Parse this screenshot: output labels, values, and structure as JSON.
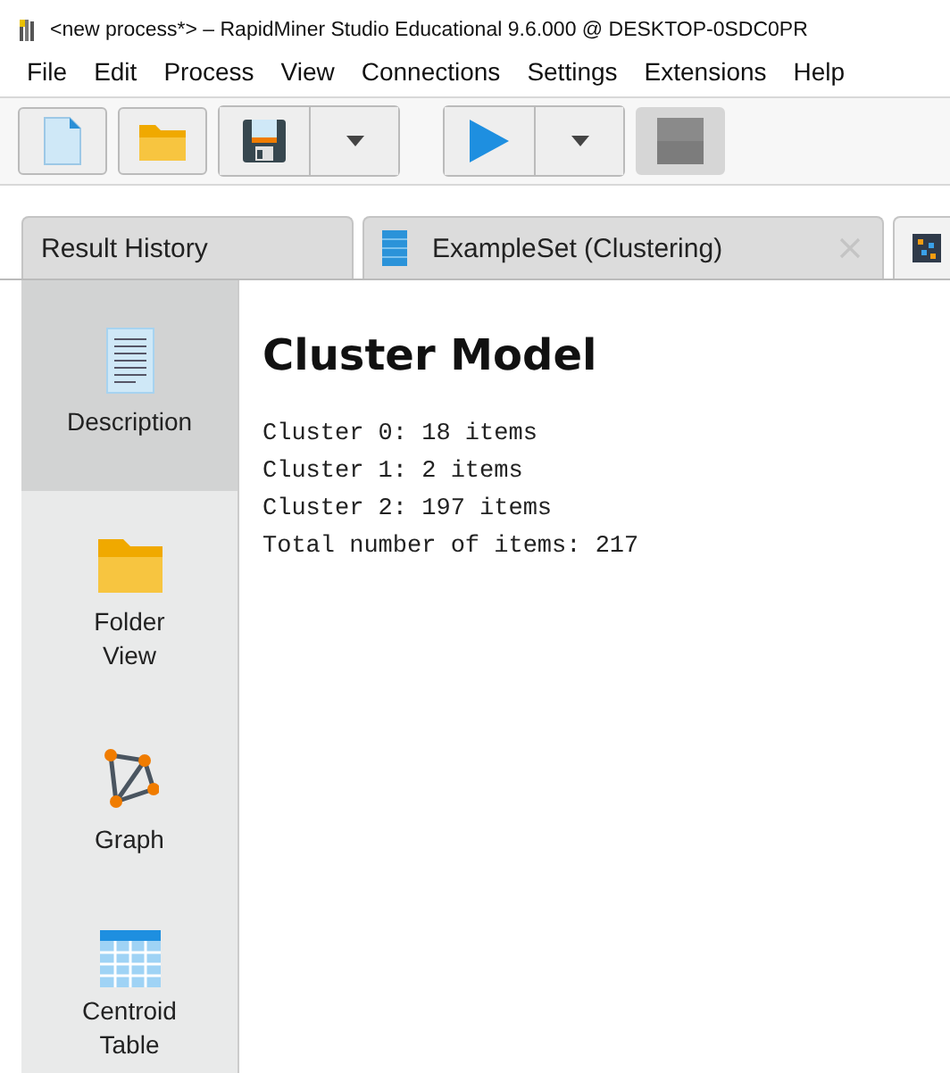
{
  "window": {
    "title": "<new process*> – RapidMiner Studio Educational 9.6.000 @ DESKTOP-0SDC0PR"
  },
  "menu": [
    "File",
    "Edit",
    "Process",
    "View",
    "Connections",
    "Settings",
    "Extensions",
    "Help"
  ],
  "toolbar": [
    {
      "kind": "new",
      "disabled": false
    },
    {
      "kind": "open",
      "disabled": false
    },
    {
      "kind": "save",
      "disabled": false,
      "dropdown": true
    },
    {
      "kind": "run",
      "disabled": false,
      "dropdown": true
    },
    {
      "kind": "stop",
      "disabled": true
    }
  ],
  "tabs": [
    {
      "kind": "history",
      "label": "Result History",
      "closable": false,
      "selected": false
    },
    {
      "kind": "table",
      "label": "ExampleSet (Clustering)",
      "closable": true,
      "selected": false
    },
    {
      "kind": "scatter",
      "closable": false,
      "selected": true
    }
  ],
  "sidebar": {
    "items": [
      {
        "kind": "document",
        "label": "Description",
        "selected": true
      },
      {
        "kind": "folder",
        "label": "Folder View",
        "selected": false
      },
      {
        "kind": "graph",
        "label": "Graph",
        "selected": false
      },
      {
        "kind": "table",
        "label": "Centroid Table",
        "selected": false
      }
    ]
  },
  "content": {
    "heading": "Cluster Model",
    "lines": [
      "Cluster 0: 18 items",
      "Cluster 1: 2 items",
      "Cluster 2: 197 items",
      "Total number of items: 217"
    ]
  }
}
